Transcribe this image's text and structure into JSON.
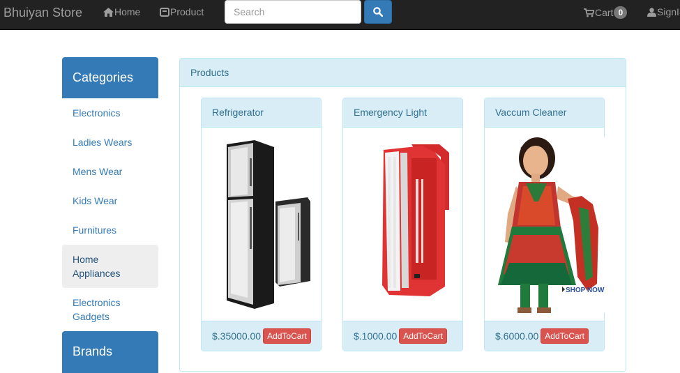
{
  "navbar": {
    "brand": "Bhuiyan Store",
    "home_label": "Home",
    "product_label": "Product",
    "search_placeholder": "Search",
    "cart_label": "Cart",
    "cart_count": "0",
    "signin_label": "SignI"
  },
  "sidebar": {
    "categories_title": "Categories",
    "items": [
      {
        "label": "Electronics"
      },
      {
        "label": "Ladies Wears"
      },
      {
        "label": "Mens Wear"
      },
      {
        "label": "Kids Wear"
      },
      {
        "label": "Furnitures"
      },
      {
        "label": "Home Appliances",
        "active": true
      },
      {
        "label": "Electronics Gadgets"
      }
    ],
    "brands_title": "Brands"
  },
  "main": {
    "panel_title": "Products",
    "products": [
      {
        "name": "Refrigerator",
        "price": "$.35000.00",
        "button": "AddToCart"
      },
      {
        "name": "Emergency Light",
        "price": "$.1000.00",
        "button": "AddToCart"
      },
      {
        "name": "Vaccum Cleaner",
        "price": "$.6000.00",
        "button": "AddToCart",
        "image_overlay": "SHOP NOW"
      }
    ]
  },
  "colors": {
    "navbar_bg": "#222222",
    "primary": "#337ab7",
    "info_bg": "#d9edf7",
    "danger": "#d9534f"
  }
}
